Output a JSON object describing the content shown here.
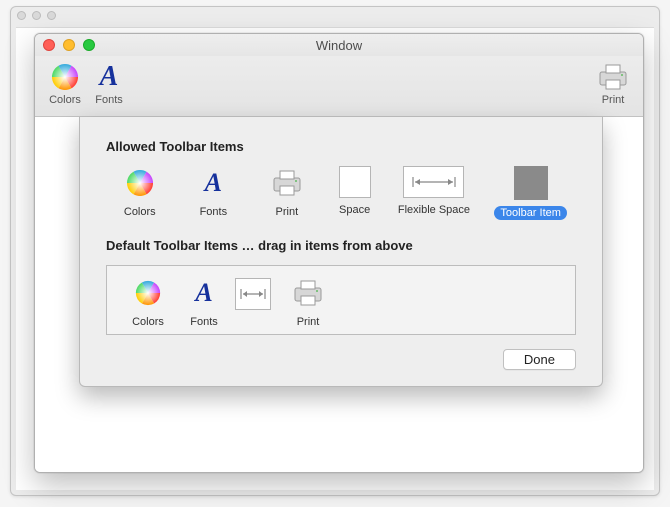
{
  "window": {
    "title": "Window"
  },
  "toolbar": {
    "colors": "Colors",
    "fonts": "Fonts",
    "print": "Print"
  },
  "sheet": {
    "allowed_heading": "Allowed Toolbar Items",
    "default_heading": "Default Toolbar Items … drag in items from above",
    "done": "Done"
  },
  "allowed": {
    "colors": "Colors",
    "fonts": "Fonts",
    "print": "Print",
    "space": "Space",
    "flexible_space": "Flexible Space",
    "toolbar_item": "Toolbar Item"
  },
  "defaults": {
    "colors": "Colors",
    "fonts": "Fonts",
    "print": "Print"
  }
}
